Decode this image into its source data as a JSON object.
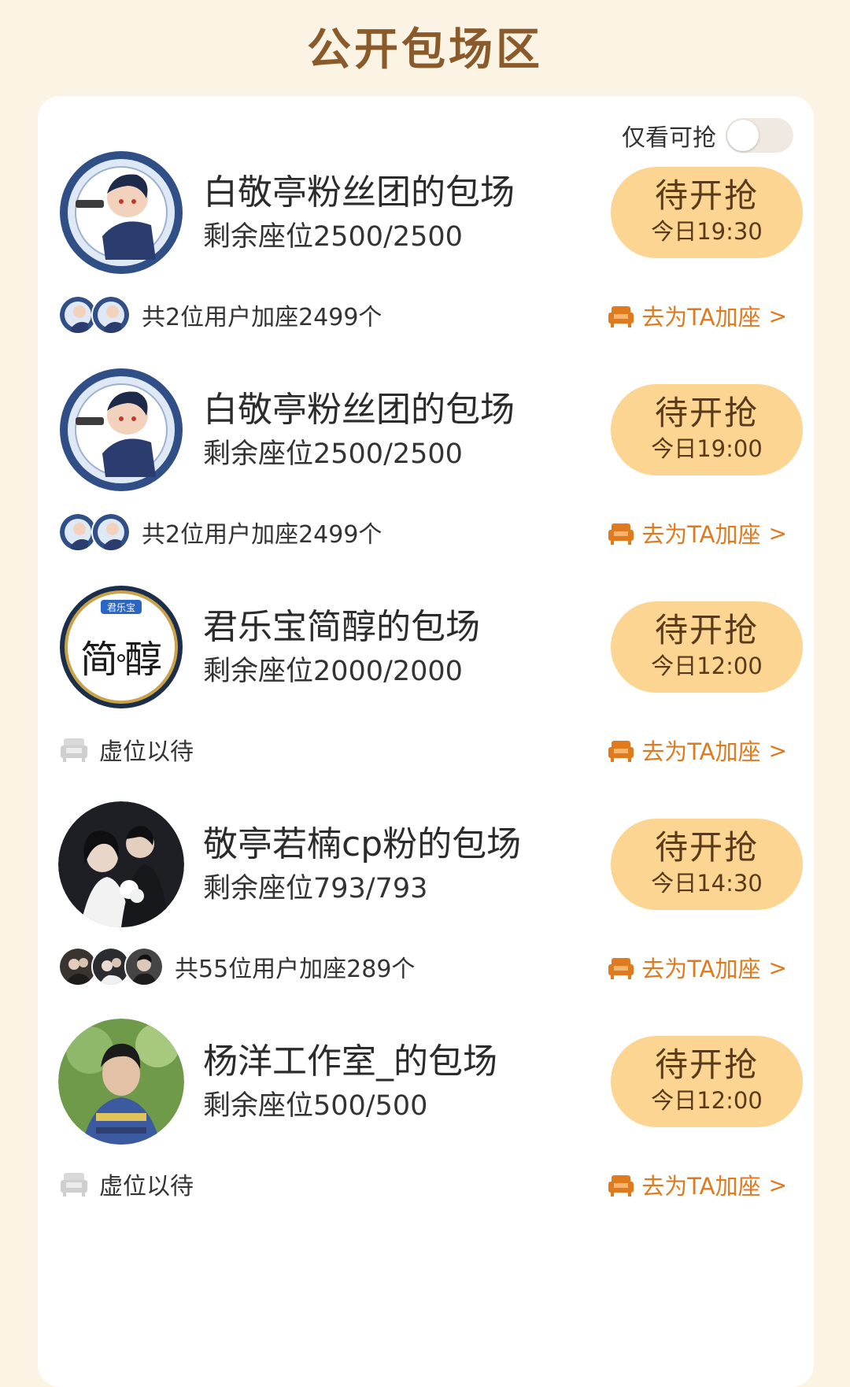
{
  "page": {
    "title": "公开包场区"
  },
  "filter": {
    "label": "仅看可抢",
    "enabled": false
  },
  "join_label": "去为TA加座",
  "join_chevron": ">",
  "entries": [
    {
      "name": "白敬亭粉丝团的包场",
      "seats": "剩余座位2500/2500",
      "status": "待开抢",
      "time": "今日19:30",
      "sub_type": "users",
      "sub_text": "共2位用户加座2499个",
      "avatar": "cartoon-gunman-avatar"
    },
    {
      "name": "白敬亭粉丝团的包场",
      "seats": "剩余座位2500/2500",
      "status": "待开抢",
      "time": "今日19:00",
      "sub_type": "users",
      "sub_text": "共2位用户加座2499个",
      "avatar": "cartoon-gunman-avatar"
    },
    {
      "name": "君乐宝简醇的包场",
      "seats": "剩余座位2000/2000",
      "status": "待开抢",
      "time": "今日12:00",
      "sub_type": "empty",
      "sub_text": "虚位以待",
      "avatar": "jianchun-logo-avatar",
      "logo_text": {
        "brand": "君乐宝",
        "char1": "简",
        "char2": "醇"
      }
    },
    {
      "name": "敬亭若楠cp粉的包场",
      "seats": "剩余座位793/793",
      "status": "待开抢",
      "time": "今日14:30",
      "sub_type": "users",
      "sub_text": "共55位用户加座289个",
      "avatar": "couple-photo-avatar"
    },
    {
      "name": "杨洋工作室_的包场",
      "seats": "剩余座位500/500",
      "status": "待开抢",
      "time": "今日12:00",
      "sub_type": "empty",
      "sub_text": "虚位以待",
      "avatar": "portrait-photo-avatar"
    }
  ],
  "colors": {
    "background": "#fbf3e4",
    "title": "#8a5a2b",
    "pill": "#fbd591",
    "accent": "#e07a1f"
  }
}
